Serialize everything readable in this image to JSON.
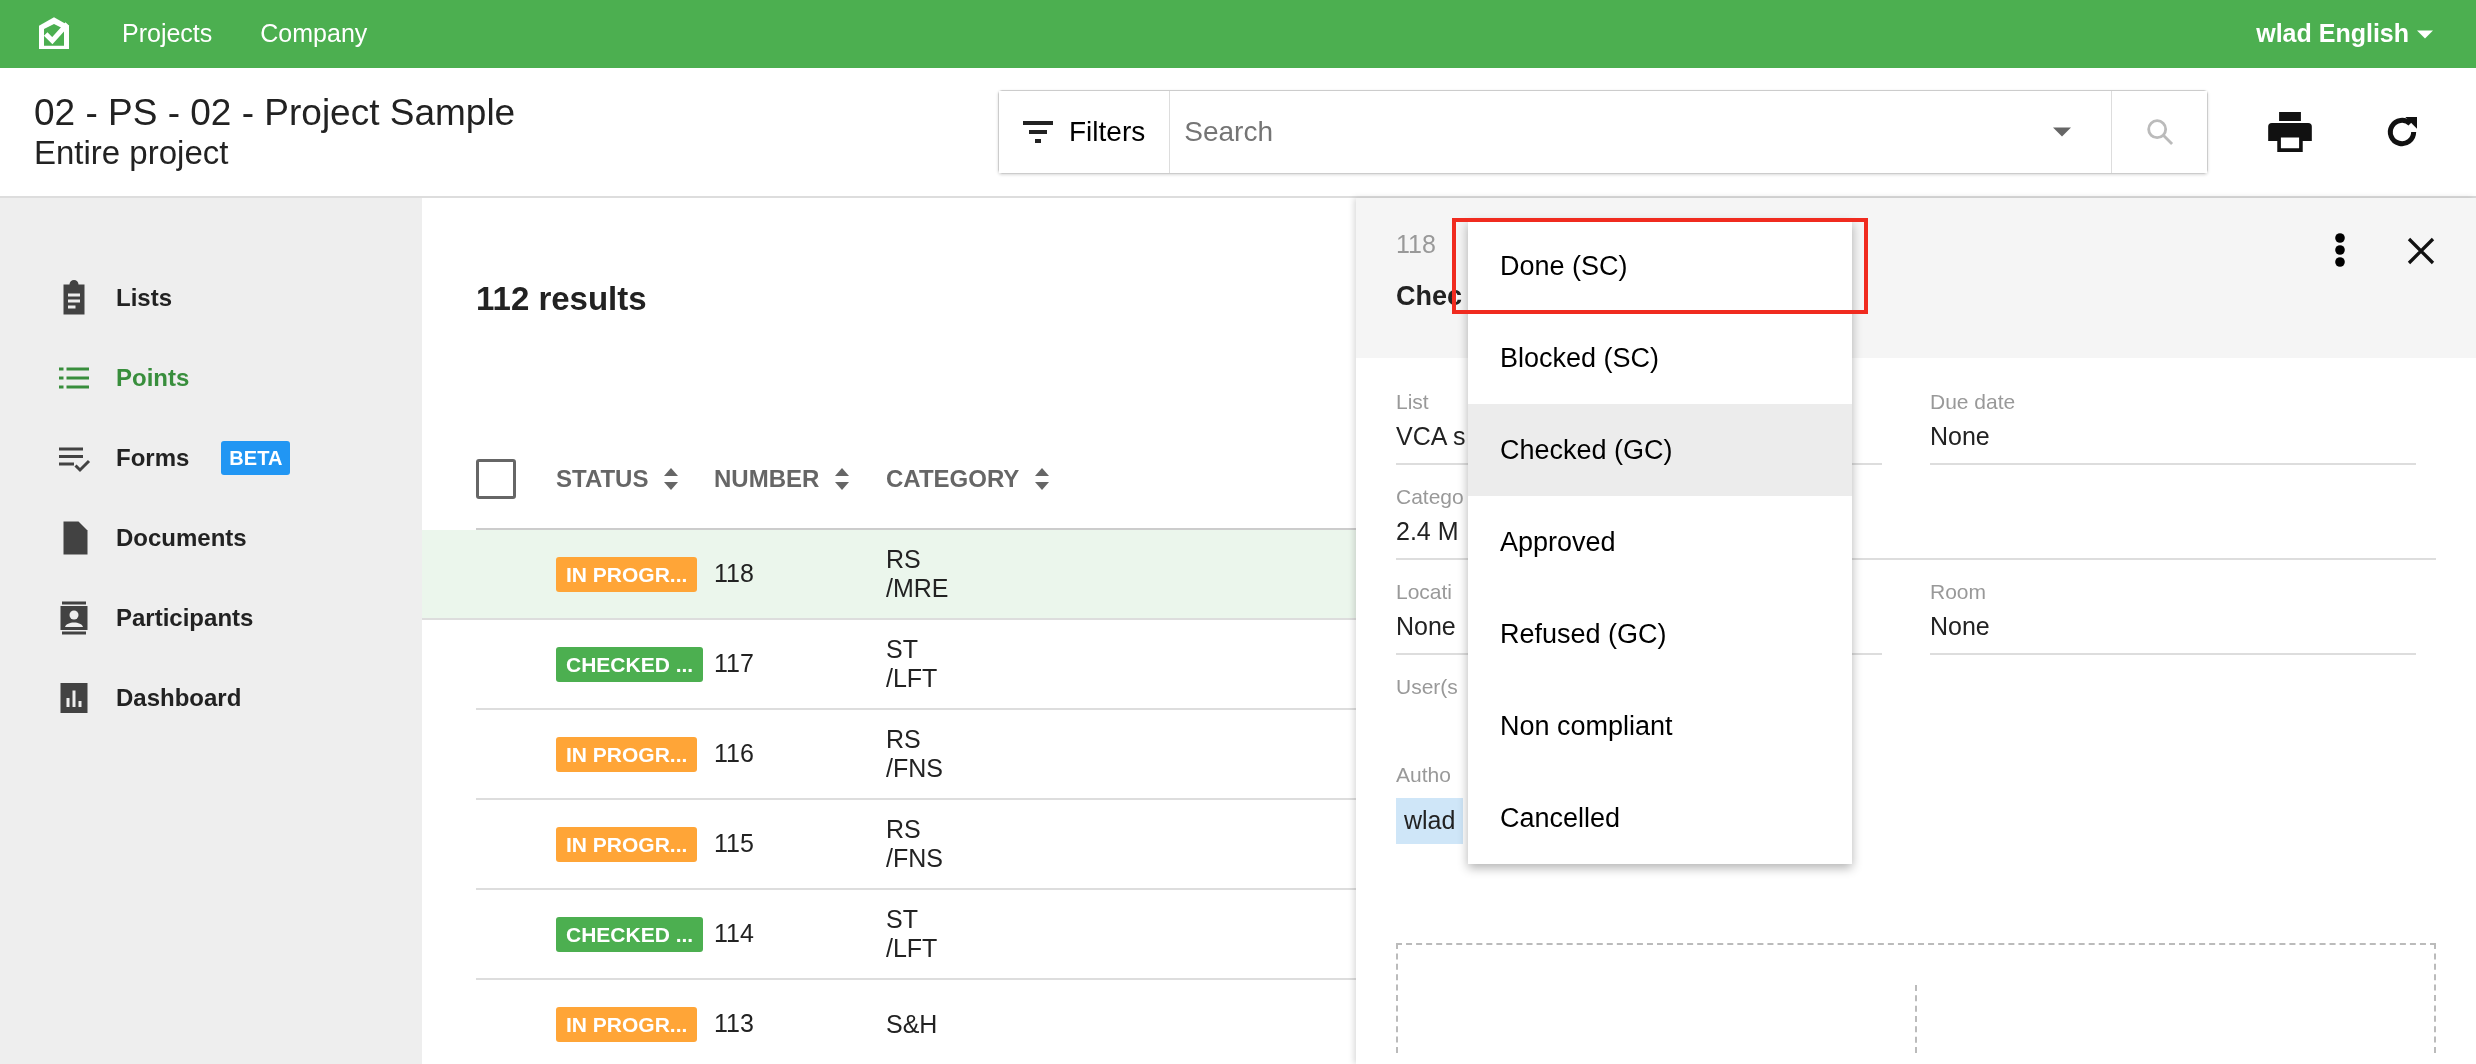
{
  "topbar": {
    "nav": [
      "Projects",
      "Company"
    ],
    "user_menu": "wlad English"
  },
  "header": {
    "title": "02 - PS - 02 - Project Sample",
    "subtitle": "Entire project",
    "filters": "Filters",
    "search": {
      "placeholder": "Search"
    }
  },
  "sidebar": {
    "items": [
      {
        "label": "Lists",
        "selected": false
      },
      {
        "label": "Points",
        "selected": true
      },
      {
        "label": "Forms",
        "selected": false,
        "badge": "BETA"
      },
      {
        "label": "Documents",
        "selected": false
      },
      {
        "label": "Participants",
        "selected": false
      },
      {
        "label": "Dashboard",
        "selected": false
      }
    ]
  },
  "results": "112 results",
  "table": {
    "select_all": {
      "checked": false
    },
    "columns": [
      "STATUS",
      "NUMBER",
      "CATEGORY"
    ],
    "rows": [
      {
        "status": "IN PROGR...",
        "color": "#ffa537",
        "number": "118",
        "category": [
          "RS",
          "/MRE"
        ],
        "selected": true
      },
      {
        "status": "CHECKED ...",
        "color": "#4caf50",
        "number": "117",
        "category": [
          "ST",
          "/LFT"
        ],
        "selected": false
      },
      {
        "status": "IN PROGR...",
        "color": "#ffa537",
        "number": "116",
        "category": [
          "RS",
          "/FNS"
        ],
        "selected": false
      },
      {
        "status": "IN PROGR...",
        "color": "#ffa537",
        "number": "115",
        "category": [
          "RS",
          "/FNS"
        ],
        "selected": false
      },
      {
        "status": "CHECKED ...",
        "color": "#4caf50",
        "number": "114",
        "category": [
          "ST",
          "/LFT"
        ],
        "selected": false
      },
      {
        "status": "IN PROGR...",
        "color": "#ffa537",
        "number": "113",
        "category": [
          "S&H"
        ],
        "selected": false
      }
    ]
  },
  "panel": {
    "number": "118",
    "title": "Chec",
    "fields": [
      {
        "label": "List",
        "value": "VCA s",
        "kind": "left"
      },
      {
        "label": "Due date",
        "value": "None",
        "kind": "right"
      },
      {
        "label": "Catego",
        "value": "2.4 M",
        "kind": "wide"
      },
      {
        "label": "Locati",
        "value": "None",
        "kind": "left"
      },
      {
        "label": "Room",
        "value": "None",
        "kind": "right"
      },
      {
        "label": "User(s",
        "kind": "label"
      },
      {
        "label": "Autho",
        "chip": "wlad",
        "kind": "chip"
      }
    ]
  },
  "status_menu": {
    "items": [
      {
        "label": "Done (SC)",
        "selected": false,
        "highlighted": true
      },
      {
        "label": "Blocked (SC)",
        "selected": false,
        "highlighted": false
      },
      {
        "label": "Checked (GC)",
        "selected": true,
        "highlighted": false
      },
      {
        "label": "Approved",
        "selected": false,
        "highlighted": false
      },
      {
        "label": "Refused (GC)",
        "selected": false,
        "highlighted": false
      },
      {
        "label": "Non compliant",
        "selected": false,
        "highlighted": false
      },
      {
        "label": "Cancelled",
        "selected": false,
        "highlighted": false
      }
    ]
  }
}
